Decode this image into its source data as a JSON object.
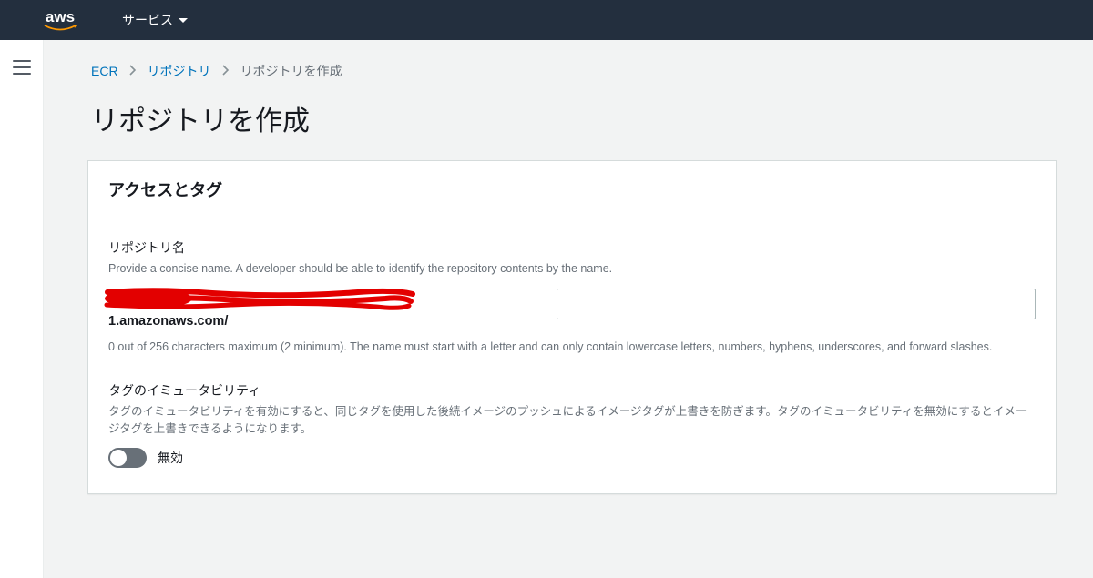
{
  "nav": {
    "logo_text": "aws",
    "services_label": "サービス"
  },
  "breadcrumb": {
    "root": "ECR",
    "repos": "リポジトリ",
    "current": "リポジトリを作成"
  },
  "page": {
    "title": "リポジトリを作成"
  },
  "panel": {
    "header": "アクセスとタグ",
    "repo_name": {
      "label": "リポジトリ名",
      "help": "Provide a concise name. A developer should be able to identify the repository contents by the name.",
      "prefix_suffix": "1.amazonaws.com/",
      "input_value": "",
      "constraint": "0 out of 256 characters maximum (2 minimum). The name must start with a letter and can only contain lowercase letters, numbers, hyphens, underscores, and forward slashes."
    },
    "immutability": {
      "label": "タグのイミュータビリティ",
      "help": "タグのイミュータビリティを有効にすると、同じタグを使用した後続イメージのプッシュによるイメージタグが上書きを防ぎます。タグのイミュータビリティを無効にするとイメージタグを上書きできるようになります。",
      "toggle_state": "無効"
    }
  }
}
